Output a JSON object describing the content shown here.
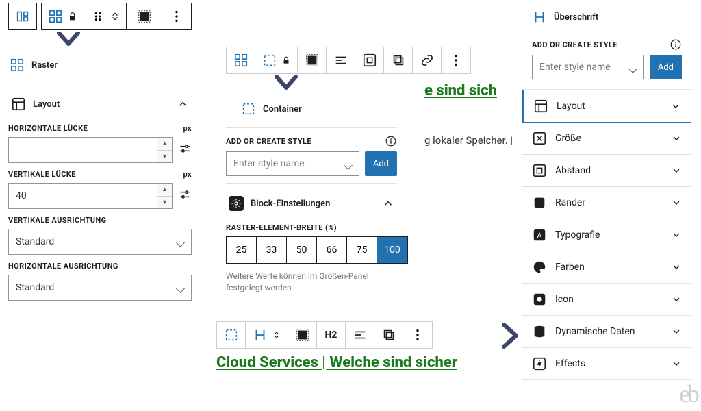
{
  "left": {
    "block_name": "Raster",
    "section_layout": "Layout",
    "h_gap_label": "HORIZONTALE LÜCKE",
    "v_gap_label": "VERTIKALE LÜCKE",
    "unit": "px",
    "h_gap_value": "",
    "v_gap_value": "40",
    "v_align_label": "VERTIKALE AUSRICHTUNG",
    "h_align_label": "HORIZONTALE AUSRICHTUNG",
    "align_value": "Standard"
  },
  "mid": {
    "block_name": "Container",
    "style_heading": "ADD OR CREATE STYLE",
    "style_placeholder": "Enter style name",
    "add_btn": "Add",
    "block_settings": "Block-Einstellungen",
    "width_label": "RASTER-ELEMENT-BREITE (%)",
    "widths": [
      "25",
      "33",
      "50",
      "66",
      "75",
      "100"
    ],
    "width_selected": "100",
    "width_hint": "Weitere Werte können im Größen-Panel festgelegt werden.",
    "h2_label": "H2",
    "heading_text": "Cloud Services | Welche sind sicher",
    "overlay_text1": "e sind sich",
    "overlay_text2": "g lokaler Speicher. |"
  },
  "right": {
    "block_name": "Überschrift",
    "style_heading": "ADD OR CREATE STYLE",
    "style_placeholder": "Enter style name",
    "add_btn": "Add",
    "sections": [
      {
        "id": "layout",
        "label": "Layout",
        "active": true
      },
      {
        "id": "size",
        "label": "Größe"
      },
      {
        "id": "spacing",
        "label": "Abstand"
      },
      {
        "id": "border",
        "label": "Ränder"
      },
      {
        "id": "typo",
        "label": "Typografie"
      },
      {
        "id": "colors",
        "label": "Farben"
      },
      {
        "id": "icon",
        "label": "Icon"
      },
      {
        "id": "dynamic",
        "label": "Dynamische Daten"
      },
      {
        "id": "effects",
        "label": "Effects"
      }
    ]
  },
  "colors": {
    "accent": "#2271b1",
    "pointer": "#3b4668",
    "green": "#1a7a20"
  }
}
